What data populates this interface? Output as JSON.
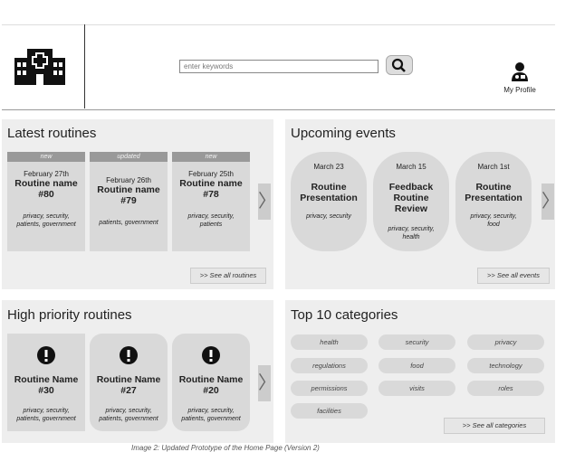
{
  "header": {
    "logo_icon": "hospital-icon",
    "search_placeholder": "enter keywords",
    "search_icon": "magnifier-icon",
    "profile_icon": "doctor-icon",
    "profile_label": "My Profile"
  },
  "latest": {
    "title": "Latest routines",
    "cards": [
      {
        "tag": "new",
        "date": "February 27th",
        "name1": "Routine name",
        "name2": "#80",
        "tags1": "privacy, security,",
        "tags2": "patients, government"
      },
      {
        "tag": "updated",
        "date": "February 26th",
        "name1": "Routine name",
        "name2": "#79",
        "tags1": "patients, government",
        "tags2": ""
      },
      {
        "tag": "new",
        "date": "February 25th",
        "name1": "Routine name",
        "name2": "#78",
        "tags1": "privacy, security,",
        "tags2": "patients"
      }
    ],
    "see_all": ">> See all routines"
  },
  "upcoming": {
    "title": "Upcoming events",
    "events": [
      {
        "date": "March 23",
        "l1": "Routine",
        "l2": "Presentation",
        "l3": "",
        "tags1": "privacy, security",
        "tags2": "",
        "tags3": ""
      },
      {
        "date": "March 15",
        "l1": "Feedback",
        "l2": "Routine",
        "l3": "Review",
        "tags1": "privacy, security,",
        "tags2": "health",
        "tags3": ""
      },
      {
        "date": "March 1st",
        "l1": "Routine",
        "l2": "Presentation",
        "l3": "",
        "tags1": "privacy, security,",
        "tags2": "food",
        "tags3": ""
      }
    ],
    "see_all": ">> See all events"
  },
  "priority": {
    "title": "High priority routines",
    "cards": [
      {
        "name1": "Routine Name",
        "name2": "#30",
        "tags1": "privacy, security,",
        "tags2": "patients, government"
      },
      {
        "name1": "Routine Name",
        "name2": "#27",
        "tags1": "privacy, security,",
        "tags2": "patients, government"
      },
      {
        "name1": "Routine Name",
        "name2": "#20",
        "tags1": "privacy, security,",
        "tags2": "patients, government"
      }
    ]
  },
  "categories": {
    "title": "Top 10 categories",
    "items": [
      "health",
      "security",
      "privacy",
      "regulations",
      "food",
      "technology",
      "permissions",
      "visits",
      "roles",
      "facilities"
    ],
    "see_all": ">> See all categories"
  },
  "caption": "Image 2: Updated Prototype of the Home Page (Version 2)",
  "arrow": "〉"
}
